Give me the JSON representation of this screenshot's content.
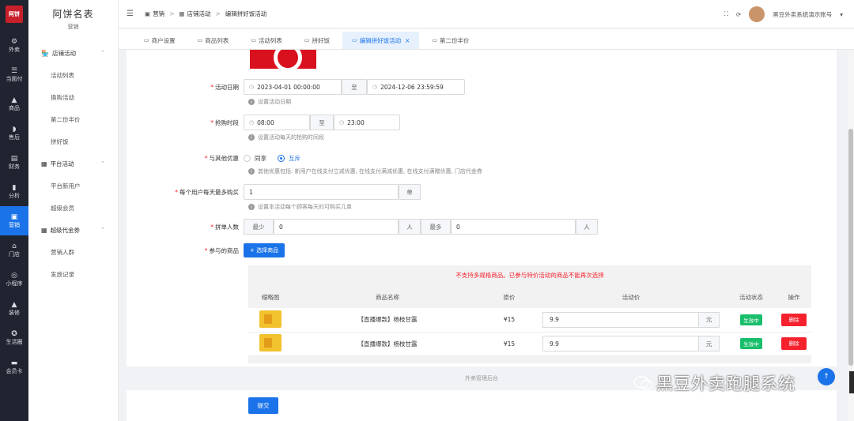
{
  "rail": {
    "logo": "阿饼",
    "items": [
      {
        "label": "外卖",
        "icon": "takeout-icon"
      },
      {
        "label": "当面付",
        "icon": "pay-icon"
      },
      {
        "label": "商品",
        "icon": "goods-icon"
      },
      {
        "label": "售后",
        "icon": "headset-icon"
      },
      {
        "label": "财务",
        "icon": "finance-icon"
      },
      {
        "label": "分析",
        "icon": "chart-icon"
      },
      {
        "label": "营销",
        "icon": "marketing-icon",
        "active": true
      },
      {
        "label": "门店",
        "icon": "store-icon"
      },
      {
        "label": "小程序",
        "icon": "miniapp-icon"
      },
      {
        "label": "装修",
        "icon": "decorate-icon"
      },
      {
        "label": "生活圈",
        "icon": "circle-icon"
      },
      {
        "label": "会员卡",
        "icon": "card-icon"
      }
    ]
  },
  "submenu": {
    "shop_name": "阿饼名表",
    "section": "营销",
    "groups": [
      {
        "label": "店铺活动",
        "items": [
          "活动列表",
          "换购活动",
          "第二份半价",
          "拼好饭"
        ]
      },
      {
        "label": "平台活动",
        "items": [
          "平台新用户",
          "超级会员"
        ]
      },
      {
        "label": "超级代金券",
        "items": [
          "营销人群",
          "发放记录"
        ]
      }
    ]
  },
  "breadcrumb": [
    "营销",
    "店铺活动",
    "编辑拼好饭活动"
  ],
  "account": "黑豆外卖系统演示账号",
  "tabs": [
    {
      "label": "商户设置"
    },
    {
      "label": "商品列表"
    },
    {
      "label": "活动列表"
    },
    {
      "label": "拼好饭"
    },
    {
      "label": "编辑拼好饭活动",
      "active": true
    },
    {
      "label": "第二份半价"
    }
  ],
  "form": {
    "date": {
      "label": "活动日期",
      "start": "2023-04-01 00:00:00",
      "to": "至",
      "end": "2024-12-06 23:59:59",
      "hint": "设置活动日期"
    },
    "time": {
      "label": "抢购时段",
      "start": "08:00",
      "to": "至",
      "end": "23:00",
      "hint": "设置活动每天的抢购时间段"
    },
    "share": {
      "label": "与其他优惠",
      "opt1": "同享",
      "opt2": "互斥",
      "selected": "互斥",
      "hint": "其他优惠包括: 新用户在线支付立减优惠, 在线支付满减优惠, 在线支付满赠优惠, 门店代金券"
    },
    "limit": {
      "label": "每个用户每天最多购买",
      "value": "1",
      "unit": "单",
      "hint": "设置本活动每个顾客每天的可购买几单"
    },
    "group": {
      "label": "拼单人数",
      "min_label": "最少",
      "min_value": "0",
      "max_label": "最多",
      "max_value": "0",
      "unit": "人"
    },
    "goods": {
      "label": "参与的商品",
      "select_button": "+ 选择商品"
    }
  },
  "goods_table": {
    "warning": "不支持多规格商品。已参与特价活动的商品不能再次选择",
    "headers": [
      "缩略图",
      "商品名称",
      "原价",
      "活动价",
      "活动状态",
      "操作"
    ],
    "rows": [
      {
        "name": "【直播爆款】杨枝甘露",
        "price": "¥15",
        "activity_price": "9.9",
        "unit": "元",
        "status": "生效中",
        "action": "删除"
      },
      {
        "name": "【直播爆款】杨枝甘露",
        "price": "¥15",
        "activity_price": "9.9",
        "unit": "元",
        "status": "生效中",
        "action": "删除"
      }
    ]
  },
  "footer": "外卖管理后台",
  "submit": "提交",
  "watermark": "黑豆外卖跑腿系统",
  "colors": {
    "primary": "#1a73e8",
    "danger": "#f5222d",
    "success": "#19be6b",
    "rail": "#1f2430"
  }
}
